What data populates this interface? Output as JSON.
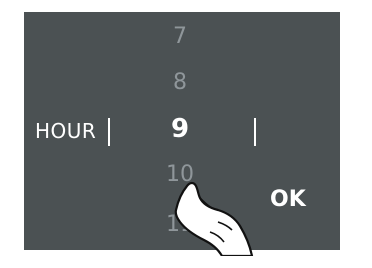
{
  "picker": {
    "label": "HOUR",
    "values": [
      "7",
      "8",
      "9",
      "10",
      "11"
    ],
    "selected_value": "9"
  },
  "actions": {
    "ok_label": "OK"
  },
  "overlay": {
    "gesture_icon": "hand-swipe-icon"
  }
}
